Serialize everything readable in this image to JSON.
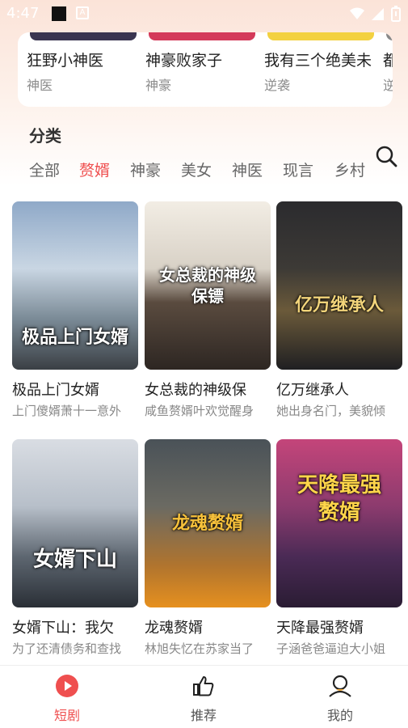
{
  "status": {
    "time": "4:47"
  },
  "recommend": [
    {
      "title": "狂野小神医",
      "tag": "神医",
      "color": "#3a3550"
    },
    {
      "title": "神豪败家子",
      "tag": "神豪",
      "color": "#d43a5a"
    },
    {
      "title": "我有三个绝美未",
      "tag": "逆袭",
      "color": "#f3d140"
    },
    {
      "title": "都",
      "tag": "逆",
      "color": "#888888"
    }
  ],
  "category": {
    "title": "分类",
    "tabs": [
      "全部",
      "赘婿",
      "神豪",
      "美女",
      "神医",
      "现言",
      "乡村"
    ],
    "active": "赘婿"
  },
  "dramas": [
    {
      "title": "极品上门女婿",
      "desc": "上门傻婿萧十一意外",
      "poster_text": "极品上门女婿"
    },
    {
      "title": "女总裁的神级保",
      "desc": "咸鱼赘婿叶欢觉醒身",
      "poster_text": "女总裁的神级保镖"
    },
    {
      "title": "亿万继承人",
      "desc": "她出身名门，美貌倾",
      "poster_text": "亿万继承人"
    },
    {
      "title": "女婿下山：我欠",
      "desc": "为了还清债务和查找",
      "poster_text": "女婿下山"
    },
    {
      "title": "龙魂赘婿",
      "desc": "林旭失忆在苏家当了",
      "poster_text": "龙魂赘婿"
    },
    {
      "title": "天降最强赘婿",
      "desc": "子涵爸爸逼迫大小姐",
      "poster_text": "天降最强赘婿"
    }
  ],
  "nav": [
    {
      "label": "短剧",
      "icon": "play-icon",
      "active": true
    },
    {
      "label": "推荐",
      "icon": "thumbs-up-icon",
      "active": false
    },
    {
      "label": "我的",
      "icon": "profile-icon",
      "active": false
    }
  ],
  "colors": {
    "accent": "#ef4f4f"
  }
}
